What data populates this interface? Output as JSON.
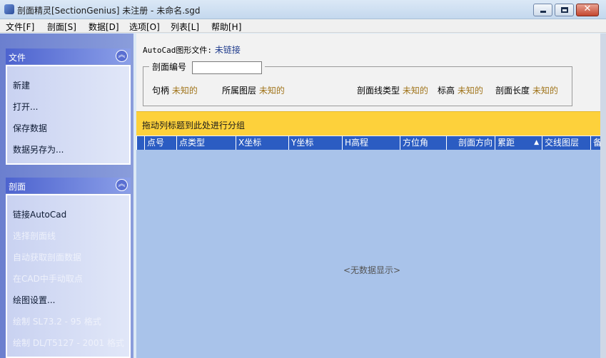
{
  "window": {
    "title": "剖面精灵[SectionGenius] 未注册 - 未命名.sgd",
    "close_label": "✕"
  },
  "menu": [
    "文件[F]",
    "剖面[S]",
    "数据[D]",
    "选项[O]",
    "列表[L]",
    "帮助[H]"
  ],
  "sidebar": {
    "file_group": {
      "title": "文件",
      "items": [
        "新建",
        "打开...",
        "保存数据",
        "数据另存为..."
      ]
    },
    "section_group": {
      "title": "剖面",
      "items": [
        {
          "label": "链接AutoCad",
          "enabled": true
        },
        {
          "label": "选择剖面线",
          "enabled": false
        },
        {
          "label": "自动获取剖面数据",
          "enabled": false
        },
        {
          "label": "在CAD中手动取点",
          "enabled": false
        },
        {
          "label": "绘图设置...",
          "enabled": true
        },
        {
          "label": "绘制 SL73.2 - 95 格式",
          "enabled": false
        },
        {
          "label": "绘制 DL/T5127 - 2001 格式",
          "enabled": false
        }
      ]
    },
    "collapse_glyph": "︽"
  },
  "main": {
    "cad_label": "AutoCad图形文件:",
    "cad_value": "未链接",
    "section_number_label": "剖面编号",
    "section_number_value": "",
    "info": {
      "handle": {
        "label": "句柄",
        "value": "未知的"
      },
      "layer": {
        "label": "所属图层",
        "value": "未知的"
      },
      "linetype": {
        "label": "剖面线类型",
        "value": "未知的"
      },
      "elevation": {
        "label": "标高",
        "value": "未知的"
      },
      "length": {
        "label": "剖面长度",
        "value": "未知的"
      }
    },
    "group_hint": "拖动列标题到此处进行分组",
    "columns": [
      "点号",
      "点类型",
      "X坐标",
      "Y坐标",
      "H高程",
      "方位角",
      "剖面方向",
      "累距",
      "交线图层",
      "备"
    ],
    "sort_indicator": "▲",
    "empty_text": "<无数据显示>"
  },
  "colors": {
    "accent": "#2b5cc2",
    "group_bar": "#fdd13b",
    "sidebar_header": "#4d63cf",
    "grid_body": "#a9c3ea"
  }
}
